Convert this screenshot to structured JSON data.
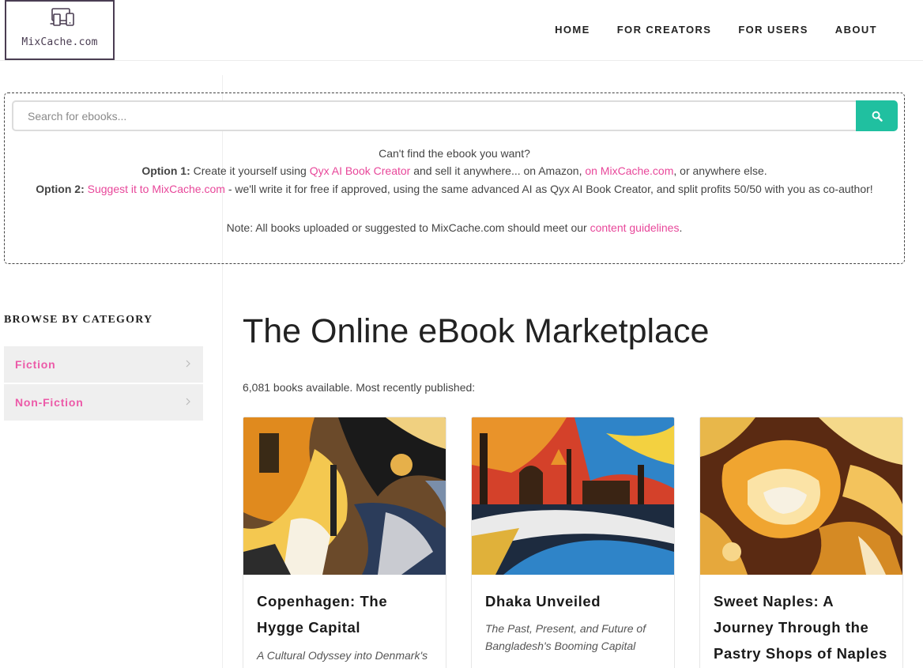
{
  "header": {
    "logo_text": "MixCache.com",
    "nav": [
      "HOME",
      "FOR CREATORS",
      "FOR USERS",
      "ABOUT"
    ]
  },
  "search": {
    "placeholder": "Search for ebooks...",
    "cant_find": "Can't find the ebook you want?",
    "option1_label": "Option 1:",
    "option1_pre": "Create it yourself using",
    "option1_link": "Qyx AI Book Creator",
    "option1_mid": "and sell it anywhere... on Amazon,",
    "option1_link2": "on MixCache.com",
    "option1_post": ", or anywhere else.",
    "option2_label": "Option 2:",
    "option2_link": "Suggest it to MixCache.com",
    "option2_post": "- we'll write it for free if approved, using the same advanced AI as Qyx AI Book Creator, and split profits 50/50 with you as co-author!",
    "note_pre": "Note: All books uploaded or suggested to MixCache.com should meet our",
    "note_link": "content guidelines",
    "note_post": "."
  },
  "sidebar": {
    "title": "BROWSE BY CATEGORY",
    "categories": [
      "Fiction",
      "Non-Fiction"
    ]
  },
  "main": {
    "title": "The Online eBook Marketplace",
    "count_line": "6,081 books available. Most recently published:",
    "books": [
      {
        "title": "Copenhagen: The Hygge Capital",
        "subtitle": "A Cultural Odyssey into Denmark's Most Charming City"
      },
      {
        "title": "Dhaka Unveiled",
        "subtitle": "The Past, Present, and Future of Bangladesh's Booming Capital"
      },
      {
        "title": "Sweet Naples: A Journey Through the Pastry Shops of Naples",
        "subtitle": ""
      }
    ]
  },
  "colors": {
    "accent_teal": "#20c0a0",
    "link_pink": "#e8479a",
    "logo_purple": "#4a3d52"
  },
  "icons": [
    "devices-icon",
    "search-icon",
    "chevron-right-icon"
  ]
}
